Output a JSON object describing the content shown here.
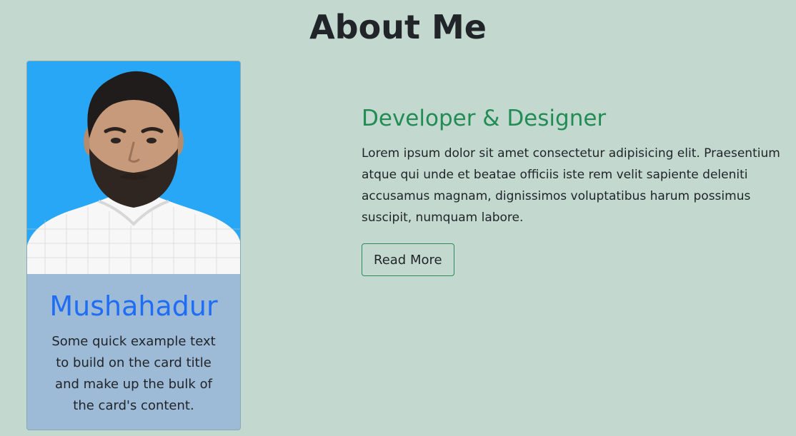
{
  "page": {
    "title": "About Me"
  },
  "profile_card": {
    "name": "Mushahadur",
    "text": "Some quick example text to build on the card title and make up the bulk of the card's content."
  },
  "about": {
    "subtitle": "Developer & Designer",
    "text": "Lorem ipsum dolor sit amet consectetur adipisicing elit. Praesentium atque qui unde et beatae officiis iste rem velit sapiente deleniti accusamus magnam, dignissimos voluptatibus harum possimus suscipit, numquam labore.",
    "button_label": "Read More"
  },
  "colors": {
    "background": "#c3d9d0",
    "card_body": "#9dbad6",
    "photo_background": "#27a7f5",
    "card_title": "#1f6df5",
    "subtitle": "#228c55",
    "button_border": "#2c8a5c"
  }
}
